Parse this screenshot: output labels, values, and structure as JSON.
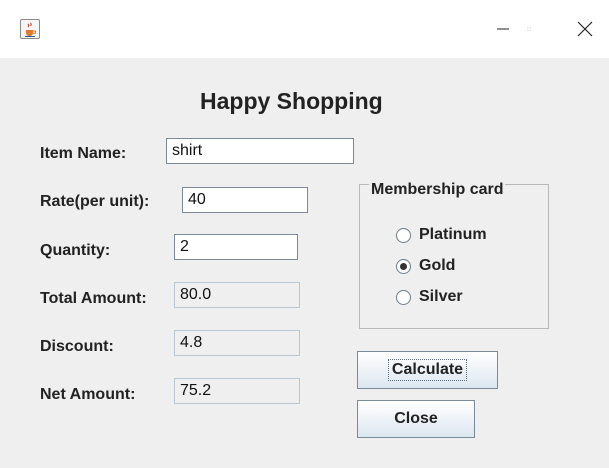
{
  "window": {
    "minimize_glyph": "—",
    "maximize_glyph": "☐",
    "close_glyph": "✕",
    "icon": "java-cup-icon"
  },
  "title": "Happy Shopping",
  "form": {
    "item_name": {
      "label": "Item Name:",
      "value": "shirt"
    },
    "rate": {
      "label": "Rate(per unit):",
      "value": "40"
    },
    "quantity": {
      "label": "Quantity:",
      "value": "2"
    },
    "total_amount": {
      "label": "Total Amount:",
      "value": "80.0"
    },
    "discount": {
      "label": "Discount:",
      "value": "4.8"
    },
    "net_amount": {
      "label": "Net Amount:",
      "value": "75.2"
    }
  },
  "membership": {
    "title": "Membership card",
    "options": [
      {
        "label": "Platinum",
        "selected": false
      },
      {
        "label": "Gold",
        "selected": true
      },
      {
        "label": "Silver",
        "selected": false
      }
    ]
  },
  "buttons": {
    "calculate": "Calculate",
    "close": "Close"
  }
}
